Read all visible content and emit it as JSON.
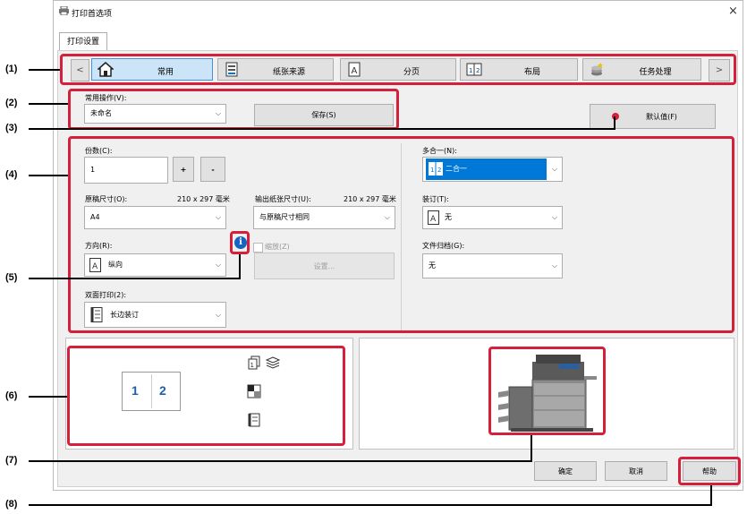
{
  "window": {
    "title": "打印首选项",
    "close_symbol": "×"
  },
  "tab": {
    "label": "打印设置"
  },
  "nav": {
    "prev": "<",
    "next": ">",
    "tabs": [
      {
        "label": "常用",
        "icon": "home-icon"
      },
      {
        "label": "纸张来源",
        "icon": "paper-tray-icon"
      },
      {
        "label": "分页",
        "icon": "page-icon"
      },
      {
        "label": "布局",
        "icon": "layout-icon"
      },
      {
        "label": "任务处理",
        "icon": "job-icon"
      }
    ]
  },
  "favorites": {
    "label": "常用操作(V):",
    "value": "未命名",
    "save": "保存(S)",
    "default": "默认值(F)"
  },
  "settings": {
    "copies_label": "份数(C):",
    "copies_value": "1",
    "plus": "+",
    "minus": "-",
    "original_size_label": "原稿尺寸(O):",
    "original_size_dim": "210 x 297 毫米",
    "original_size_value": "A4",
    "output_size_label": "输出纸张尺寸(U):",
    "output_size_dim": "210 x 297 毫米",
    "output_size_value": "与原稿尺寸相同",
    "orientation_label": "方向(R):",
    "orientation_value": "纵向",
    "zoom_label": "缩放(Z)",
    "zoom_settings": "设置...",
    "duplex_label": "双面打印(2):",
    "duplex_value": "长边装订",
    "nup_label": "多合一(N):",
    "nup_value": "二合一",
    "staple_label": "装订(T):",
    "staple_value": "无",
    "retention_label": "文件归档(G):",
    "retention_value": "无"
  },
  "preview": {
    "page1": "1",
    "page2": "2"
  },
  "footer": {
    "ok": "确定",
    "cancel": "取消",
    "help": "帮助"
  },
  "callouts": [
    "(1)",
    "(2)",
    "(3)",
    "(4)",
    "(5)",
    "(6)",
    "(7)",
    "(8)"
  ],
  "colors": {
    "highlight": "#d61f3a",
    "selection": "#0078d7",
    "preview_digits": "#1f5fa8"
  }
}
